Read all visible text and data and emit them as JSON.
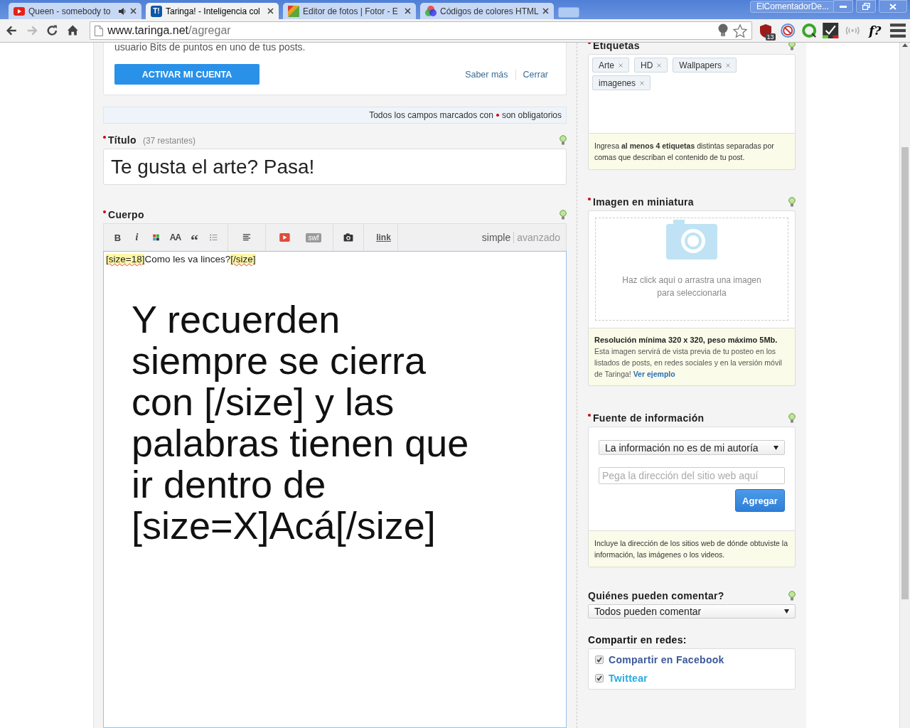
{
  "browser": {
    "tabs": [
      {
        "title": "Queen - somebody to",
        "kind": "youtube",
        "audio": true,
        "selected": false
      },
      {
        "title": "Taringa! - Inteligencia col",
        "kind": "taringa",
        "favicon_text": "T!",
        "audio": false,
        "selected": true
      },
      {
        "title": "Editor de fotos | Fotor - E",
        "kind": "fotor",
        "audio": false,
        "selected": false
      },
      {
        "title": "Códigos de colores HTML",
        "kind": "colors",
        "audio": false,
        "selected": false
      }
    ],
    "profile": "ElComentadorDe...",
    "forward_disabled": true,
    "address": {
      "host": "www.taringa.net",
      "path": "/agregar"
    },
    "extensions": [
      {
        "kind": "shield",
        "badge": "13"
      },
      {
        "kind": "block"
      },
      {
        "kind": "qcircle"
      },
      {
        "kind": "check"
      },
      {
        "kind": "signal"
      },
      {
        "kind": "text",
        "label": "f?"
      },
      {
        "kind": "menu"
      }
    ]
  },
  "notice": {
    "text": "usuario Bits de puntos en uno de tus posts.",
    "button": "ACTIVAR MI CUENTA",
    "links": [
      "Saber más",
      "Cerrar"
    ]
  },
  "required_note": {
    "before": "Todos los campos marcados con",
    "after": "son obligatorios"
  },
  "title_field": {
    "label": "Título",
    "required": true,
    "remaining": "(37 restantes)",
    "value": "Te gusta el arte? Pasa!"
  },
  "body": {
    "label": "Cuerpo",
    "required": true,
    "toolbar": [
      [
        {
          "kind": "bold",
          "label": "B"
        },
        {
          "kind": "italic",
          "label": "i"
        },
        {
          "kind": "colors"
        },
        {
          "kind": "size",
          "label": "AA"
        },
        {
          "kind": "quote",
          "label": "“"
        },
        {
          "kind": "list"
        }
      ],
      [
        {
          "kind": "align"
        }
      ],
      [
        {
          "kind": "video"
        },
        {
          "kind": "swf",
          "label": "swf"
        }
      ],
      [
        {
          "kind": "camera"
        }
      ],
      [
        {
          "kind": "link",
          "label": "link"
        }
      ]
    ],
    "modes": [
      {
        "label": "simple",
        "selected": true
      },
      {
        "label": "avanzado",
        "selected": false
      }
    ],
    "first_line": [
      {
        "kind": "tag",
        "text": "[size=18]"
      },
      {
        "kind": "text",
        "text": "Como les va linces?"
      },
      {
        "kind": "tag",
        "text": "[/size]"
      }
    ],
    "big_text": "Y recuerden siempre se cierra con [/size] y las palabras tienen que ir dentro de [size=X]Acá[/size]"
  },
  "tags_field": {
    "label": "Etiquetas",
    "required": true,
    "tags": [
      "Arte",
      "HD",
      "Wallpapers",
      "imagenes"
    ],
    "hint": "Ingresa **al menos 4 etiquetas** distintas separadas por comas que describan el contenido de tu post."
  },
  "thumbnail": {
    "label": "Imagen en miniatura",
    "required": true,
    "drop_text": "Haz click aquí o arrastra una imagen para seleccionarla",
    "info_title": "Resolución mínima 320 x 320, peso máximo 5Mb.",
    "info": "Esta imagen servirá de vista previa de tu posteo en los listados de posts, en redes sociales y en la versión móvil de Taringa!",
    "info_link": "Ver ejemplo"
  },
  "source": {
    "label": "Fuente de información",
    "required": true,
    "select": "La información no es de mi autoría",
    "placeholder": "Pega la dirección del sitio web aquí",
    "button": "Agregar",
    "hint": "Incluye la dirección de los sitios web de dónde obtuviste la información, las imágenes o los videos."
  },
  "comments": {
    "label": "Quiénes pueden comentar?",
    "select": "Todos pueden comentar"
  },
  "share": {
    "label": "Compartir en redes:",
    "options": [
      {
        "label": "Compartir en Facebook",
        "checked": true,
        "color": "#3b5998"
      },
      {
        "label": "Twittear",
        "checked": true,
        "color": "#29aae1"
      }
    ]
  }
}
